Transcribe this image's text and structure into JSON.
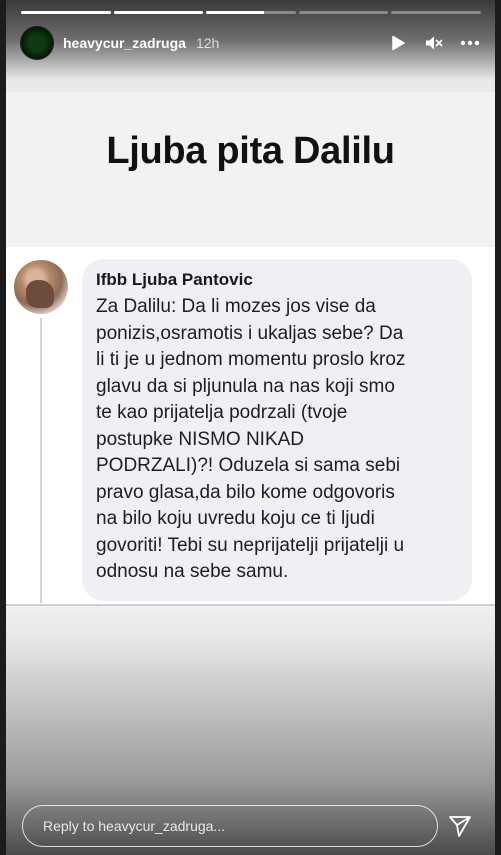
{
  "story": {
    "progress": [
      1.0,
      1.0,
      0.65,
      0.0,
      0.0
    ],
    "header": {
      "username": "heavycur_zadruga",
      "time": "12h",
      "icons": [
        "play-icon",
        "mute-icon",
        "more-icon"
      ]
    },
    "title": "Ljuba pita Dalilu",
    "post": {
      "author": "Ifbb Ljuba Pantovic",
      "comment": "Za Dalilu: Da li mozes jos vise da\nponizis,osramotis i ukaljas sebe? Da\nli ti je u jednom momentu proslo kroz\nglavu da si pljunula na nas koji smo\nte kao prijatelja podrzali (tvoje\npostupke NISMO NIKAD\nPODRZALI)?! Oduzela si sama sebi\npravo glasa,da bilo kome odgovoris\nna bilo koju uvredu koju ce ti ljudi\ngovoriti! Tebi su neprijatelji prijatelji u\nodnosu na sebe samu."
    },
    "reply": {
      "placeholder": "Reply to heavycur_zadruga..."
    }
  },
  "colors": {
    "page_bg": "#1c1c1c",
    "bubble_bg": "#eef0f3",
    "title_text": "#111111"
  }
}
